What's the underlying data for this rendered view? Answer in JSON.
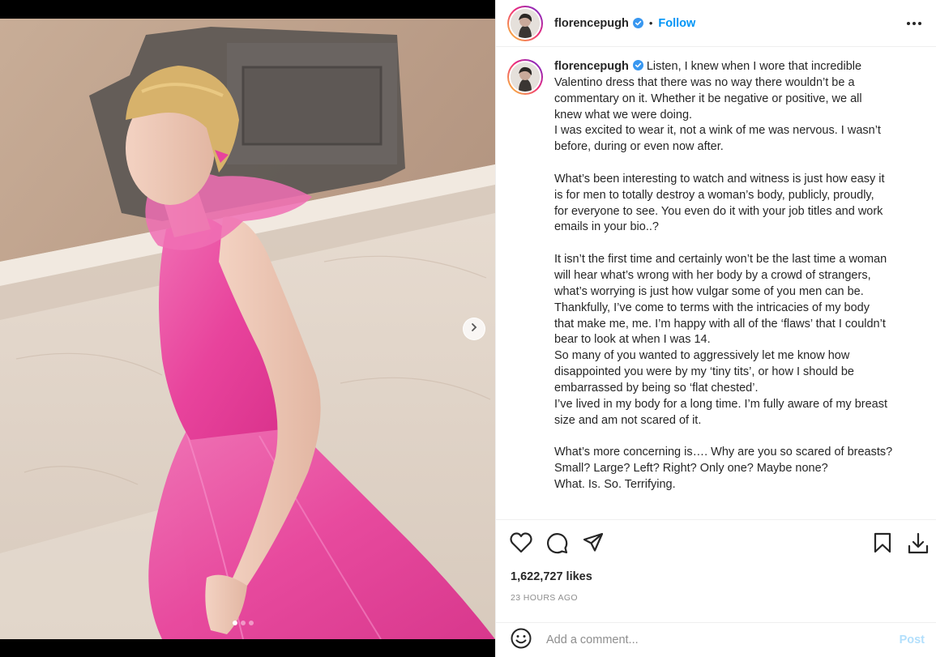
{
  "post": {
    "username": "florencepugh",
    "follow_label": "Follow",
    "separator": "•",
    "photo_count": 3,
    "active_photo": 1,
    "likes": "1,622,727 likes",
    "timestamp": "23 HOURS AGO"
  },
  "caption": {
    "username": "florencepugh",
    "lines": [
      " Listen, I knew when I wore that incredible",
      "Valentino dress that there was no way there wouldn’t be a",
      "commentary on it. Whether it be negative or positive, we all",
      "knew what we were doing.",
      "I was excited to wear it, not a wink of me was nervous. I wasn’t",
      "before, during or even now after.",
      "",
      "What’s been interesting to watch and witness is just how easy it",
      "is for men to totally destroy a woman’s body, publicly, proudly,",
      "for everyone to see. You even do it with your job titles and work",
      "emails in your bio..?",
      "",
      "It isn’t the first time and certainly won’t be the last time a woman",
      "will hear what’s wrong with her body by a crowd of strangers,",
      "what’s worrying is just how vulgar some of you men can be.",
      "Thankfully, I’ve come to terms with the intricacies of my body",
      "that make me, me. I’m happy with all of the ‘flaws’ that I couldn’t",
      "bear to look at when I was 14.",
      "So many of you wanted to aggressively let me know how",
      "disappointed you were by my ‘tiny tits’, or how I should be",
      "embarrassed by being so ‘flat chested’.",
      "I’ve lived in my body for a long time. I’m fully aware of my breast",
      "size and am not scared of it.",
      "",
      "What’s more concerning is…. Why are you so scared of breasts?",
      "Small? Large? Left? Right? Only one? Maybe none?",
      "What. Is. So. Terrifying."
    ]
  },
  "comment": {
    "placeholder": "Add a comment...",
    "post_label": "Post"
  },
  "icons": {
    "verified": "verified-badge-icon",
    "more": "more-options-icon",
    "like": "heart-icon",
    "comment": "comment-icon",
    "share": "paper-plane-icon",
    "save": "bookmark-icon",
    "download": "download-icon",
    "emoji": "emoji-icon",
    "next": "chevron-right-icon"
  },
  "colors": {
    "accent": "#0095f6",
    "post_disabled": "#b2dffc",
    "text": "#262626",
    "muted": "#8e8e8e",
    "dress_pink": "#e8439c"
  }
}
